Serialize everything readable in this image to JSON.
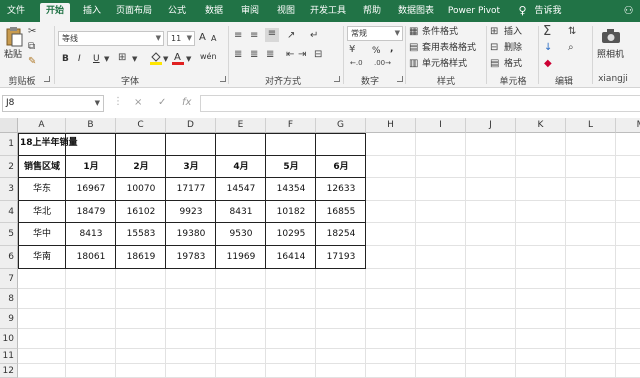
{
  "tabs": [
    "文件",
    "开始",
    "插入",
    "页面布局",
    "公式",
    "数据",
    "审阅",
    "视图",
    "开发工具",
    "帮助",
    "数据图表",
    "Power Pivot",
    "告诉我"
  ],
  "ribbon": {
    "clipboard": {
      "paste": "粘贴",
      "label": "剪贴板"
    },
    "font": {
      "family": "等线",
      "size": "11",
      "label": "字体",
      "bold": "B",
      "italic": "I",
      "underline": "U",
      "grow": "A",
      "shrink": "A",
      "wen": "wén"
    },
    "alignment": {
      "label": "对齐方式"
    },
    "number": {
      "format": "常规",
      "percent": "%",
      "comma": ",",
      "label": "数字"
    },
    "styles": {
      "conditional": "条件格式",
      "table": "套用表格格式",
      "cell": "单元格样式",
      "label": "样式"
    },
    "cells": {
      "insert": "插入",
      "delete": "删除",
      "format": "格式",
      "label": "单元格"
    },
    "editing": {
      "label": "编辑"
    },
    "camera": {
      "button": "照相机",
      "label": "xiangji"
    }
  },
  "formula_bar": {
    "name_box": "J8",
    "fx": "fx",
    "cancel": "×",
    "enter": "✓",
    "content": ""
  },
  "columns": [
    "A",
    "B",
    "C",
    "D",
    "E",
    "F",
    "G",
    "H",
    "I",
    "J",
    "K",
    "L",
    "M"
  ],
  "rows": [
    "1",
    "2",
    "3",
    "4",
    "5",
    "6",
    "7",
    "8",
    "9",
    "10",
    "11",
    "12"
  ],
  "sheet": {
    "title": "18上半年销量",
    "headers": [
      "销售区域",
      "1月",
      "2月",
      "3月",
      "4月",
      "5月",
      "6月"
    ],
    "data": [
      [
        "华东",
        "16967",
        "10070",
        "17177",
        "14547",
        "14354",
        "12633"
      ],
      [
        "华北",
        "18479",
        "16102",
        "9923",
        "8431",
        "10182",
        "16855"
      ],
      [
        "华中",
        "8413",
        "15583",
        "19380",
        "9530",
        "10295",
        "18254"
      ],
      [
        "华南",
        "18061",
        "18619",
        "19783",
        "11969",
        "16414",
        "17193"
      ]
    ]
  },
  "colors": {
    "accent": "#217346",
    "ribbon_bg": "#f3f3f3",
    "font_color_red": "#e02020",
    "fill_yellow": "#ffe600"
  }
}
